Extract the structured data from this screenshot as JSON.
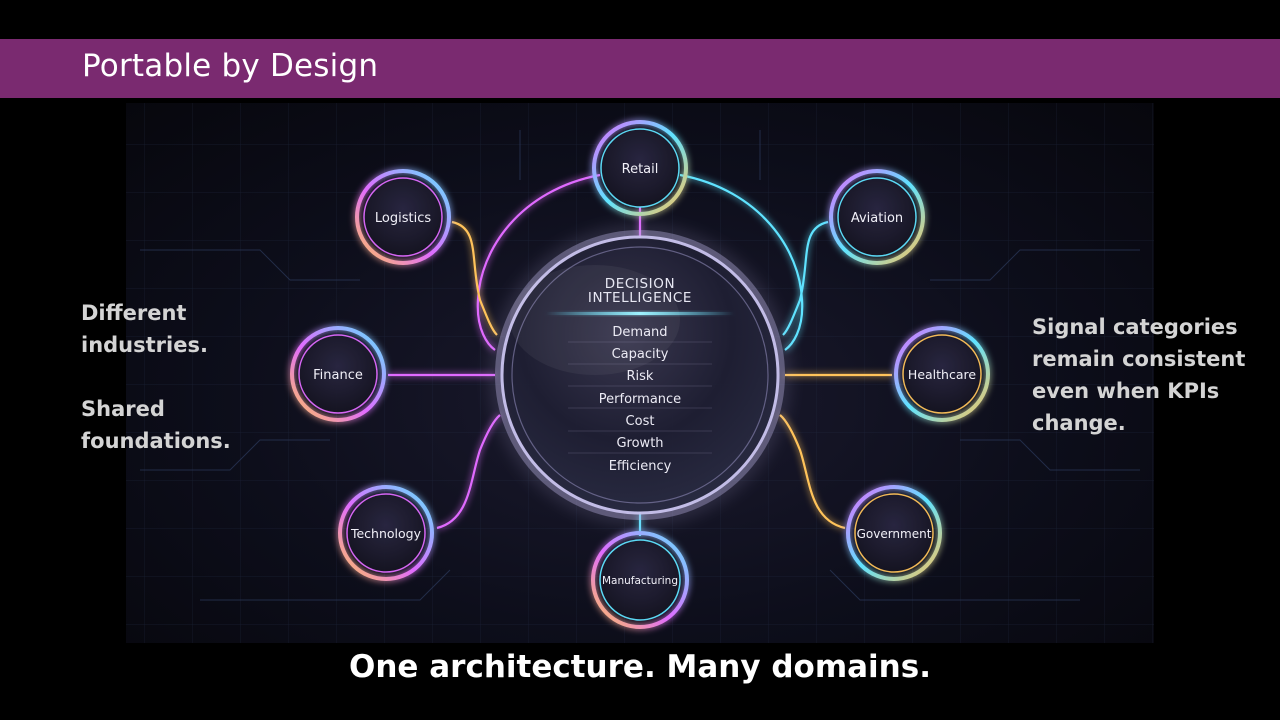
{
  "slide": {
    "title": "Portable by Design",
    "left_text_1": [
      "Different",
      "industries."
    ],
    "left_text_2": [
      "Shared",
      "foundations."
    ],
    "right_text": [
      "Signal categories",
      "remain consistent",
      "even when KPIs",
      "change."
    ],
    "tagline": "One architecture. Many domains."
  },
  "diagram": {
    "hub": {
      "title_line1": "DECISION",
      "title_line2": "INTELLIGENCE",
      "signals": [
        "Demand",
        "Capacity",
        "Risk",
        "Performance",
        "Cost",
        "Growth",
        "Efficiency"
      ]
    },
    "domains": [
      "Retail",
      "Logistics",
      "Aviation",
      "Finance",
      "Healthcare",
      "Technology",
      "Government",
      "Manufacturing"
    ]
  },
  "colors": {
    "title_bar": "#7a2a70",
    "neon_pink": "#e06bff",
    "neon_cyan": "#5fe3ff",
    "neon_amber": "#ffc35a"
  }
}
